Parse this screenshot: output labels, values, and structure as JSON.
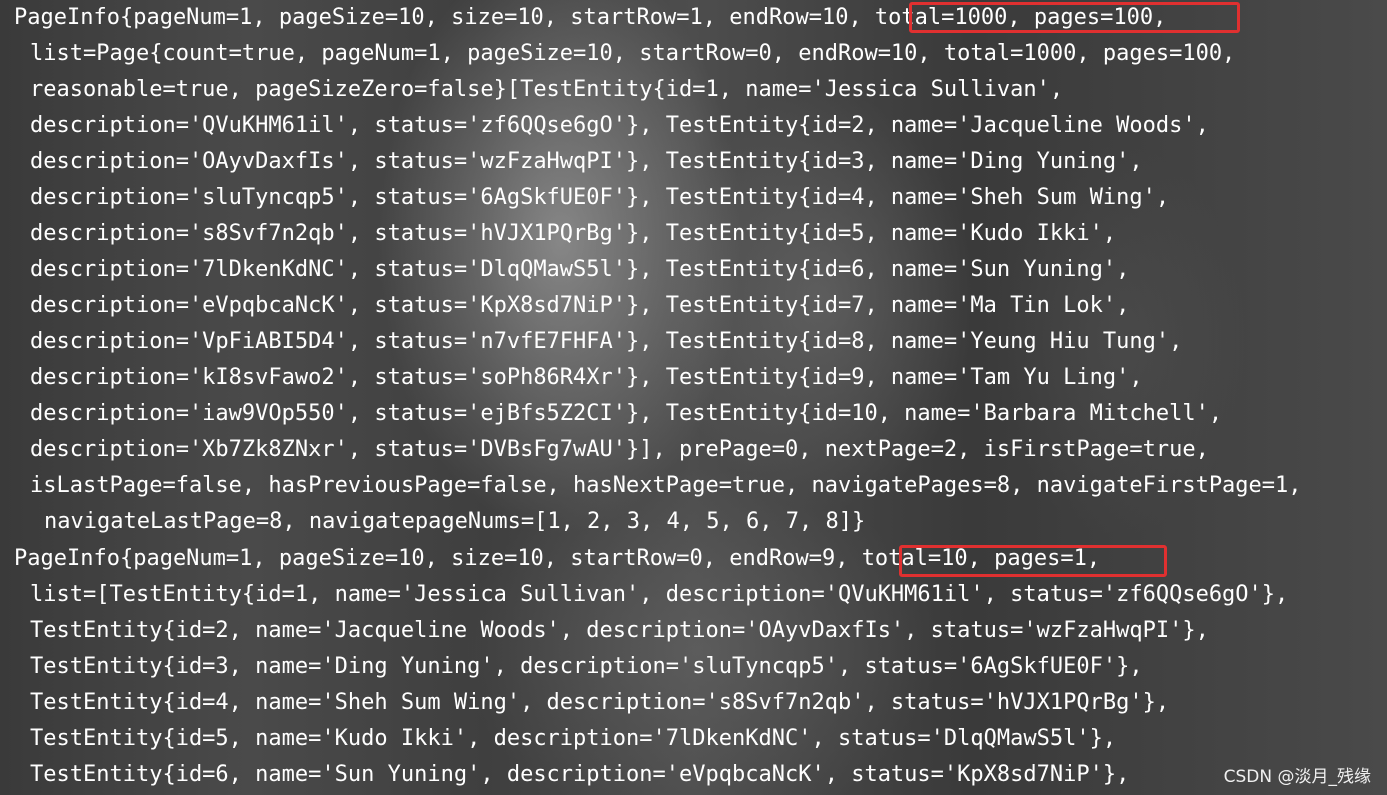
{
  "console": {
    "lines": [
      "PageInfo{pageNum=1, pageSize=10, size=10, startRow=1, endRow=10, total=1000, pages=100,",
      "list=Page{count=true, pageNum=1, pageSize=10, startRow=0, endRow=10, total=1000, pages=100,",
      "reasonable=true, pageSizeZero=false}[TestEntity{id=1, name='Jessica Sullivan',",
      "description='QVuKHM61il', status='zf6QQse6gO'}, TestEntity{id=2, name='Jacqueline Woods',",
      "description='OAyvDaxfIs', status='wzFzaHwqPI'}, TestEntity{id=3, name='Ding Yuning',",
      "description='sluTyncqp5', status='6AgSkfUE0F'}, TestEntity{id=4, name='Sheh Sum Wing',",
      "description='s8Svf7n2qb', status='hVJX1PQrBg'}, TestEntity{id=5, name='Kudo Ikki',",
      "description='7lDkenKdNC', status='DlqQMawS5l'}, TestEntity{id=6, name='Sun Yuning',",
      "description='eVpqbcaNcK', status='KpX8sd7NiP'}, TestEntity{id=7, name='Ma Tin Lok',",
      "description='VpFiABI5D4', status='n7vfE7FHFA'}, TestEntity{id=8, name='Yeung Hiu Tung',",
      "description='kI8svFawo2', status='soPh86R4Xr'}, TestEntity{id=9, name='Tam Yu Ling',",
      "description='iaw9VOp550', status='ejBfs5Z2CI'}, TestEntity{id=10, name='Barbara Mitchell',",
      "description='Xb7Zk8ZNxr', status='DVBsFg7wAU'}], prePage=0, nextPage=2, isFirstPage=true,",
      "isLastPage=false, hasPreviousPage=false, hasNextPage=true, navigatePages=8, navigateFirstPage=1,",
      "navigateLastPage=8, navigatepageNums=[1, 2, 3, 4, 5, 6, 7, 8]}",
      "PageInfo{pageNum=1, pageSize=10, size=10, startRow=0, endRow=9, total=10, pages=1,",
      "list=[TestEntity{id=1, name='Jessica Sullivan', description='QVuKHM61il', status='zf6QQse6gO'},",
      "TestEntity{id=2, name='Jacqueline Woods', description='OAyvDaxfIs', status='wzFzaHwqPI'},",
      "TestEntity{id=3, name='Ding Yuning', description='sluTyncqp5', status='6AgSkfUE0F'},",
      "TestEntity{id=4, name='Sheh Sum Wing', description='s8Svf7n2qb', status='hVJX1PQrBg'},",
      "TestEntity{id=5, name='Kudo Ikki', description='7lDkenKdNC', status='DlqQMawS5l'},",
      "TestEntity{id=6, name='Sun Yuning', description='eVpqbcaNcK', status='KpX8sd7NiP'},"
    ]
  },
  "highlights": {
    "first": "total=1000, pages=100,",
    "second": "total=10, pages=1,"
  },
  "watermark": "CSDN @淡月_残缘",
  "colors": {
    "text": "#ffffff",
    "highlight_border": "#e03030"
  }
}
